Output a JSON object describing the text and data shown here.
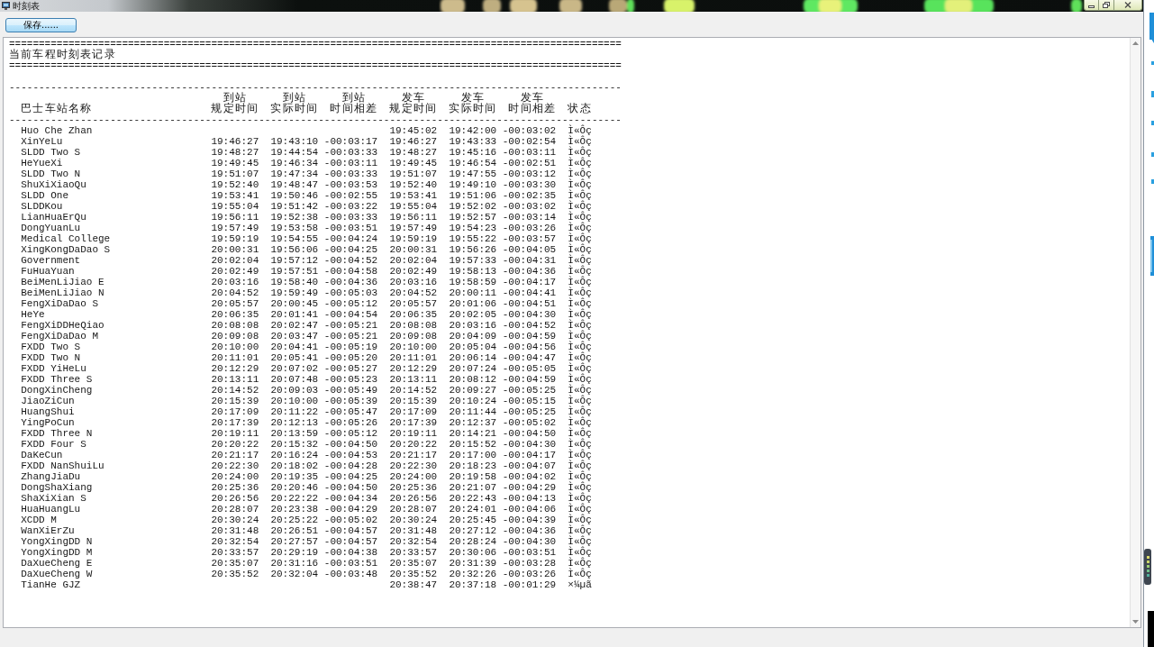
{
  "window": {
    "title": "时刻表"
  },
  "toolbar": {
    "save_button": {
      "label": "保存......"
    }
  },
  "log": {
    "banner": {
      "rule_top": "=======================================================================================================",
      "title": "当前车程时刻表记录",
      "rule_bottom": "======================================================================================================="
    },
    "timetable": {
      "rule_top": "-------------------------------------------------------------------------------------------------------",
      "columns": [
        {
          "label": "巴士车站名称"
        },
        {
          "group": "到站",
          "label": "规定时间"
        },
        {
          "group": "到站",
          "label": "实际时间"
        },
        {
          "group": "到站",
          "label": "时间相差"
        },
        {
          "group": "发车",
          "label": "规定时间"
        },
        {
          "group": "发车",
          "label": "实际时间"
        },
        {
          "group": "发车",
          "label": "时间相差"
        },
        {
          "label": "状态"
        }
      ],
      "rule_bottom": "-------------------------------------------------------------------------------------------------------",
      "rows": [
        {
          "station": "Huo Che Zhan",
          "departure_scheduled": "19:45:02",
          "departure_actual": "19:42:00",
          "departure_difference": "-00:03:02",
          "status": "Ì«Ôç"
        },
        {
          "station": "XinYeLu",
          "arrival_scheduled": "19:46:27",
          "arrival_actual": "19:43:10",
          "arrival_difference": "-00:03:17",
          "departure_scheduled": "19:46:27",
          "departure_actual": "19:43:33",
          "departure_difference": "-00:02:54",
          "status": "Ì«Ôç"
        },
        {
          "station": "SLDD Two S",
          "arrival_scheduled": "19:48:27",
          "arrival_actual": "19:44:54",
          "arrival_difference": "-00:03:33",
          "departure_scheduled": "19:48:27",
          "departure_actual": "19:45:16",
          "departure_difference": "-00:03:11",
          "status": "Ì«Ôç"
        },
        {
          "station": "HeYueXi",
          "arrival_scheduled": "19:49:45",
          "arrival_actual": "19:46:34",
          "arrival_difference": "-00:03:11",
          "departure_scheduled": "19:49:45",
          "departure_actual": "19:46:54",
          "departure_difference": "-00:02:51",
          "status": "Ì«Ôç"
        },
        {
          "station": "SLDD Two N",
          "arrival_scheduled": "19:51:07",
          "arrival_actual": "19:47:34",
          "arrival_difference": "-00:03:33",
          "departure_scheduled": "19:51:07",
          "departure_actual": "19:47:55",
          "departure_difference": "-00:03:12",
          "status": "Ì«Ôç"
        },
        {
          "station": "ShuXiXiaoQu",
          "arrival_scheduled": "19:52:40",
          "arrival_actual": "19:48:47",
          "arrival_difference": "-00:03:53",
          "departure_scheduled": "19:52:40",
          "departure_actual": "19:49:10",
          "departure_difference": "-00:03:30",
          "status": "Ì«Ôç"
        },
        {
          "station": "SLDD One",
          "arrival_scheduled": "19:53:41",
          "arrival_actual": "19:50:46",
          "arrival_difference": "-00:02:55",
          "departure_scheduled": "19:53:41",
          "departure_actual": "19:51:06",
          "departure_difference": "-00:02:35",
          "status": "Ì«Ôç"
        },
        {
          "station": "SLDDKou",
          "arrival_scheduled": "19:55:04",
          "arrival_actual": "19:51:42",
          "arrival_difference": "-00:03:22",
          "departure_scheduled": "19:55:04",
          "departure_actual": "19:52:02",
          "departure_difference": "-00:03:02",
          "status": "Ì«Ôç"
        },
        {
          "station": "LianHuaErQu",
          "arrival_scheduled": "19:56:11",
          "arrival_actual": "19:52:38",
          "arrival_difference": "-00:03:33",
          "departure_scheduled": "19:56:11",
          "departure_actual": "19:52:57",
          "departure_difference": "-00:03:14",
          "status": "Ì«Ôç"
        },
        {
          "station": "DongYuanLu",
          "arrival_scheduled": "19:57:49",
          "arrival_actual": "19:53:58",
          "arrival_difference": "-00:03:51",
          "departure_scheduled": "19:57:49",
          "departure_actual": "19:54:23",
          "departure_difference": "-00:03:26",
          "status": "Ì«Ôç"
        },
        {
          "station": "Medical College",
          "arrival_scheduled": "19:59:19",
          "arrival_actual": "19:54:55",
          "arrival_difference": "-00:04:24",
          "departure_scheduled": "19:59:19",
          "departure_actual": "19:55:22",
          "departure_difference": "-00:03:57",
          "status": "Ì«Ôç"
        },
        {
          "station": "XingKongDaDao S",
          "arrival_scheduled": "20:00:31",
          "arrival_actual": "19:56:06",
          "arrival_difference": "-00:04:25",
          "departure_scheduled": "20:00:31",
          "departure_actual": "19:56:26",
          "departure_difference": "-00:04:05",
          "status": "Ì«Ôç"
        },
        {
          "station": "Government",
          "arrival_scheduled": "20:02:04",
          "arrival_actual": "19:57:12",
          "arrival_difference": "-00:04:52",
          "departure_scheduled": "20:02:04",
          "departure_actual": "19:57:33",
          "departure_difference": "-00:04:31",
          "status": "Ì«Ôç"
        },
        {
          "station": "FuHuaYuan",
          "arrival_scheduled": "20:02:49",
          "arrival_actual": "19:57:51",
          "arrival_difference": "-00:04:58",
          "departure_scheduled": "20:02:49",
          "departure_actual": "19:58:13",
          "departure_difference": "-00:04:36",
          "status": "Ì«Ôç"
        },
        {
          "station": "BeiMenLiJiao E",
          "arrival_scheduled": "20:03:16",
          "arrival_actual": "19:58:40",
          "arrival_difference": "-00:04:36",
          "departure_scheduled": "20:03:16",
          "departure_actual": "19:58:59",
          "departure_difference": "-00:04:17",
          "status": "Ì«Ôç"
        },
        {
          "station": "BeiMenLiJiao N",
          "arrival_scheduled": "20:04:52",
          "arrival_actual": "19:59:49",
          "arrival_difference": "-00:05:03",
          "departure_scheduled": "20:04:52",
          "departure_actual": "20:00:11",
          "departure_difference": "-00:04:41",
          "status": "Ì«Ôç"
        },
        {
          "station": "FengXiDaDao S",
          "arrival_scheduled": "20:05:57",
          "arrival_actual": "20:00:45",
          "arrival_difference": "-00:05:12",
          "departure_scheduled": "20:05:57",
          "departure_actual": "20:01:06",
          "departure_difference": "-00:04:51",
          "status": "Ì«Ôç"
        },
        {
          "station": "HeYe",
          "arrival_scheduled": "20:06:35",
          "arrival_actual": "20:01:41",
          "arrival_difference": "-00:04:54",
          "departure_scheduled": "20:06:35",
          "departure_actual": "20:02:05",
          "departure_difference": "-00:04:30",
          "status": "Ì«Ôç"
        },
        {
          "station": "FengXiDDHeQiao",
          "arrival_scheduled": "20:08:08",
          "arrival_actual": "20:02:47",
          "arrival_difference": "-00:05:21",
          "departure_scheduled": "20:08:08",
          "departure_actual": "20:03:16",
          "departure_difference": "-00:04:52",
          "status": "Ì«Ôç"
        },
        {
          "station": "FengXiDaDao M",
          "arrival_scheduled": "20:09:08",
          "arrival_actual": "20:03:47",
          "arrival_difference": "-00:05:21",
          "departure_scheduled": "20:09:08",
          "departure_actual": "20:04:09",
          "departure_difference": "-00:04:59",
          "status": "Ì«Ôç"
        },
        {
          "station": "FXDD Two S",
          "arrival_scheduled": "20:10:00",
          "arrival_actual": "20:04:41",
          "arrival_difference": "-00:05:19",
          "departure_scheduled": "20:10:00",
          "departure_actual": "20:05:04",
          "departure_difference": "-00:04:56",
          "status": "Ì«Ôç"
        },
        {
          "station": "FXDD Two N",
          "arrival_scheduled": "20:11:01",
          "arrival_actual": "20:05:41",
          "arrival_difference": "-00:05:20",
          "departure_scheduled": "20:11:01",
          "departure_actual": "20:06:14",
          "departure_difference": "-00:04:47",
          "status": "Ì«Ôç"
        },
        {
          "station": "FXDD YiHeLu",
          "arrival_scheduled": "20:12:29",
          "arrival_actual": "20:07:02",
          "arrival_difference": "-00:05:27",
          "departure_scheduled": "20:12:29",
          "departure_actual": "20:07:24",
          "departure_difference": "-00:05:05",
          "status": "Ì«Ôç"
        },
        {
          "station": "FXDD Three S",
          "arrival_scheduled": "20:13:11",
          "arrival_actual": "20:07:48",
          "arrival_difference": "-00:05:23",
          "departure_scheduled": "20:13:11",
          "departure_actual": "20:08:12",
          "departure_difference": "-00:04:59",
          "status": "Ì«Ôç"
        },
        {
          "station": "DongXinCheng",
          "arrival_scheduled": "20:14:52",
          "arrival_actual": "20:09:03",
          "arrival_difference": "-00:05:49",
          "departure_scheduled": "20:14:52",
          "departure_actual": "20:09:27",
          "departure_difference": "-00:05:25",
          "status": "Ì«Ôç"
        },
        {
          "station": "JiaoZiCun",
          "arrival_scheduled": "20:15:39",
          "arrival_actual": "20:10:00",
          "arrival_difference": "-00:05:39",
          "departure_scheduled": "20:15:39",
          "departure_actual": "20:10:24",
          "departure_difference": "-00:05:15",
          "status": "Ì«Ôç"
        },
        {
          "station": "HuangShui",
          "arrival_scheduled": "20:17:09",
          "arrival_actual": "20:11:22",
          "arrival_difference": "-00:05:47",
          "departure_scheduled": "20:17:09",
          "departure_actual": "20:11:44",
          "departure_difference": "-00:05:25",
          "status": "Ì«Ôç"
        },
        {
          "station": "YingPoCun",
          "arrival_scheduled": "20:17:39",
          "arrival_actual": "20:12:13",
          "arrival_difference": "-00:05:26",
          "departure_scheduled": "20:17:39",
          "departure_actual": "20:12:37",
          "departure_difference": "-00:05:02",
          "status": "Ì«Ôç"
        },
        {
          "station": "FXDD Three N",
          "arrival_scheduled": "20:19:11",
          "arrival_actual": "20:13:59",
          "arrival_difference": "-00:05:12",
          "departure_scheduled": "20:19:11",
          "departure_actual": "20:14:21",
          "departure_difference": "-00:04:50",
          "status": "Ì«Ôç"
        },
        {
          "station": "FXDD Four S",
          "arrival_scheduled": "20:20:22",
          "arrival_actual": "20:15:32",
          "arrival_difference": "-00:04:50",
          "departure_scheduled": "20:20:22",
          "departure_actual": "20:15:52",
          "departure_difference": "-00:04:30",
          "status": "Ì«Ôç"
        },
        {
          "station": "DaKeCun",
          "arrival_scheduled": "20:21:17",
          "arrival_actual": "20:16:24",
          "arrival_difference": "-00:04:53",
          "departure_scheduled": "20:21:17",
          "departure_actual": "20:17:00",
          "departure_difference": "-00:04:17",
          "status": "Ì«Ôç"
        },
        {
          "station": "FXDD NanShuiLu",
          "arrival_scheduled": "20:22:30",
          "arrival_actual": "20:18:02",
          "arrival_difference": "-00:04:28",
          "departure_scheduled": "20:22:30",
          "departure_actual": "20:18:23",
          "departure_difference": "-00:04:07",
          "status": "Ì«Ôç"
        },
        {
          "station": "ZhangJiaDu",
          "arrival_scheduled": "20:24:00",
          "arrival_actual": "20:19:35",
          "arrival_difference": "-00:04:25",
          "departure_scheduled": "20:24:00",
          "departure_actual": "20:19:58",
          "departure_difference": "-00:04:02",
          "status": "Ì«Ôç"
        },
        {
          "station": "DongShaXiang",
          "arrival_scheduled": "20:25:36",
          "arrival_actual": "20:20:46",
          "arrival_difference": "-00:04:50",
          "departure_scheduled": "20:25:36",
          "departure_actual": "20:21:07",
          "departure_difference": "-00:04:29",
          "status": "Ì«Ôç"
        },
        {
          "station": "ShaXiXian S",
          "arrival_scheduled": "20:26:56",
          "arrival_actual": "20:22:22",
          "arrival_difference": "-00:04:34",
          "departure_scheduled": "20:26:56",
          "departure_actual": "20:22:43",
          "departure_difference": "-00:04:13",
          "status": "Ì«Ôç"
        },
        {
          "station": "HuaHuangLu",
          "arrival_scheduled": "20:28:07",
          "arrival_actual": "20:23:38",
          "arrival_difference": "-00:04:29",
          "departure_scheduled": "20:28:07",
          "departure_actual": "20:24:01",
          "departure_difference": "-00:04:06",
          "status": "Ì«Ôç"
        },
        {
          "station": "XCDD M",
          "arrival_scheduled": "20:30:24",
          "arrival_actual": "20:25:22",
          "arrival_difference": "-00:05:02",
          "departure_scheduled": "20:30:24",
          "departure_actual": "20:25:45",
          "departure_difference": "-00:04:39",
          "status": "Ì«Ôç"
        },
        {
          "station": "WanXiErZu",
          "arrival_scheduled": "20:31:48",
          "arrival_actual": "20:26:51",
          "arrival_difference": "-00:04:57",
          "departure_scheduled": "20:31:48",
          "departure_actual": "20:27:12",
          "departure_difference": "-00:04:36",
          "status": "Ì«Ôç"
        },
        {
          "station": "YongXingDD N",
          "arrival_scheduled": "20:32:54",
          "arrival_actual": "20:27:57",
          "arrival_difference": "-00:04:57",
          "departure_scheduled": "20:32:54",
          "departure_actual": "20:28:24",
          "departure_difference": "-00:04:30",
          "status": "Ì«Ôç"
        },
        {
          "station": "YongXingDD M",
          "arrival_scheduled": "20:33:57",
          "arrival_actual": "20:29:19",
          "arrival_difference": "-00:04:38",
          "departure_scheduled": "20:33:57",
          "departure_actual": "20:30:06",
          "departure_difference": "-00:03:51",
          "status": "Ì«Ôç"
        },
        {
          "station": "DaXueCheng E",
          "arrival_scheduled": "20:35:07",
          "arrival_actual": "20:31:16",
          "arrival_difference": "-00:03:51",
          "departure_scheduled": "20:35:07",
          "departure_actual": "20:31:39",
          "departure_difference": "-00:03:28",
          "status": "Ì«Ôç"
        },
        {
          "station": "DaXueCheng W",
          "arrival_scheduled": "20:35:52",
          "arrival_actual": "20:32:04",
          "arrival_difference": "-00:03:48",
          "departure_scheduled": "20:35:52",
          "departure_actual": "20:32:26",
          "departure_difference": "-00:03:26",
          "status": "Ì«Ôç"
        },
        {
          "station": "TianHe GJZ",
          "departure_scheduled": "20:38:47",
          "departure_actual": "20:37:18",
          "departure_difference": "-00:01:29",
          "status": "×¼µã"
        }
      ]
    }
  }
}
